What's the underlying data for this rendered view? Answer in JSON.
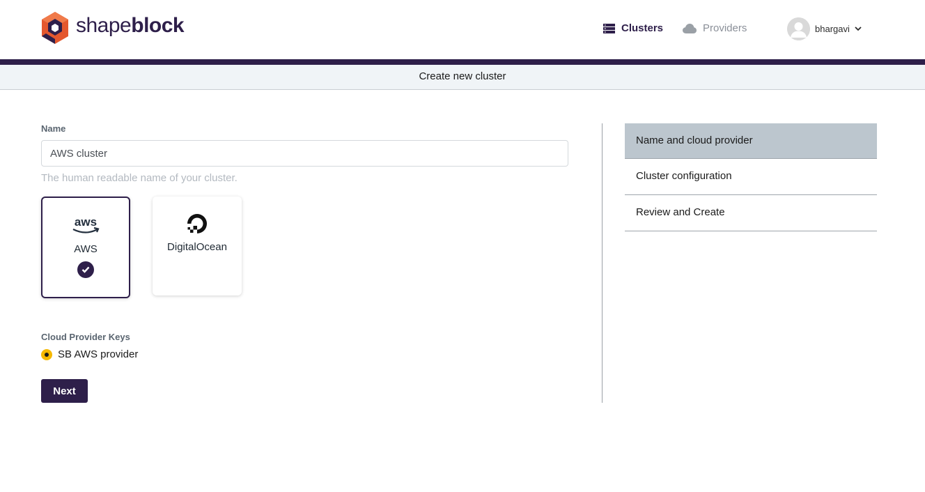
{
  "app": {
    "logo_light": "shape",
    "logo_bold": "block"
  },
  "nav": {
    "clusters_label": "Clusters",
    "providers_label": "Providers"
  },
  "user": {
    "name": "bhargavi"
  },
  "page": {
    "title": "Create new cluster"
  },
  "form": {
    "name_label": "Name",
    "name_value": "AWS cluster",
    "name_help": "The human readable name of your cluster.",
    "providers": [
      {
        "label": "AWS",
        "icon": "aws-logo-icon",
        "selected": true
      },
      {
        "label": "DigitalOcean",
        "icon": "digitalocean-logo-icon",
        "selected": false
      }
    ],
    "keys_label": "Cloud Provider Keys",
    "keys": [
      {
        "label": "SB AWS provider",
        "selected": true
      }
    ],
    "next_label": "Next"
  },
  "steps": [
    {
      "label": "Name and cloud provider",
      "active": true
    },
    {
      "label": "Cluster configuration",
      "active": false
    },
    {
      "label": "Review and Create",
      "active": false
    }
  ],
  "colors": {
    "brand": "#2e1f4a",
    "accent": "#e4572e",
    "radio": "#f5b800",
    "active_step": "#bcc6ce"
  }
}
